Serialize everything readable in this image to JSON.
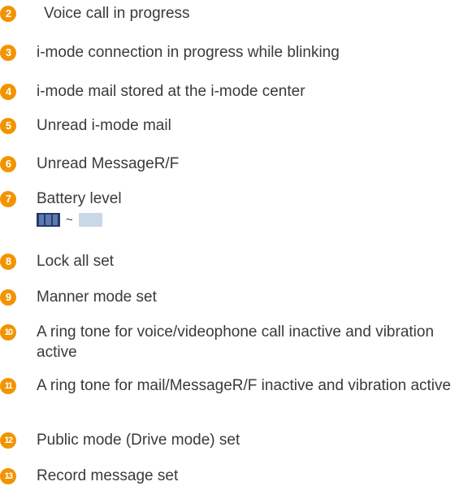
{
  "items": [
    {
      "num": "2",
      "text": "Voice call in progress"
    },
    {
      "num": "3",
      "text": "i-mode connection in progress while blinking"
    },
    {
      "num": "4",
      "text": "i-mode mail stored at the i-mode center"
    },
    {
      "num": "5",
      "text": "Unread i-mode mail"
    },
    {
      "num": "6",
      "text": "Unread MessageR/F"
    },
    {
      "num": "7",
      "text": "Battery level",
      "battery_separator": "~"
    },
    {
      "num": "8",
      "text": "Lock all set"
    },
    {
      "num": "9",
      "text": "Manner mode set"
    },
    {
      "num": "10",
      "text": "A ring tone for voice/videophone call inactive and vibration active"
    },
    {
      "num": "11",
      "text": "A ring tone for mail/MessageR/F inactive and vibration active"
    },
    {
      "num": "12",
      "text": "Public mode (Drive mode) set"
    },
    {
      "num": "13",
      "text": "Record message set"
    }
  ],
  "colors": {
    "badge": "#f29400",
    "text": "#3a3a3a",
    "battery_full": "#243a6a",
    "battery_empty": "#c9d7e6"
  }
}
